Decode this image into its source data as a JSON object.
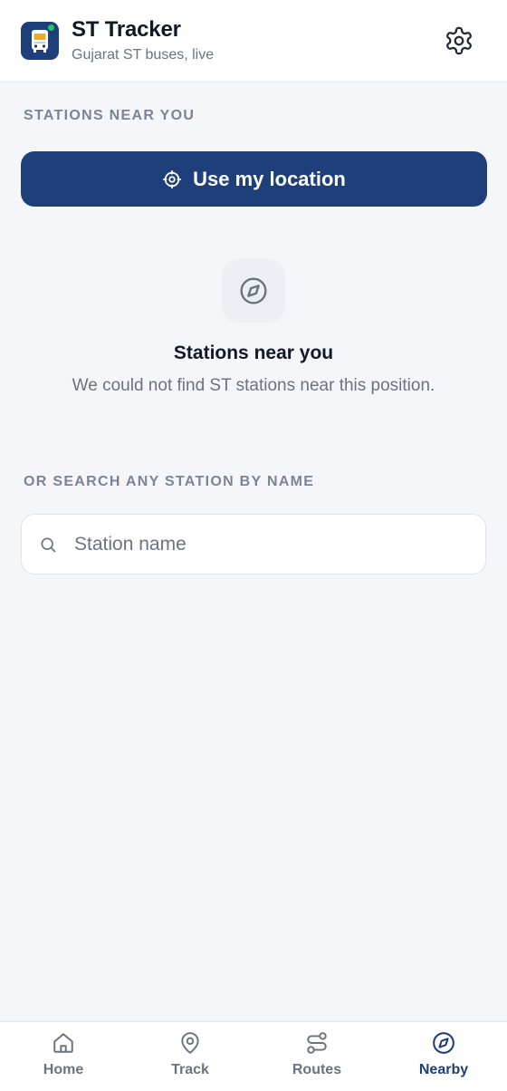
{
  "app": {
    "title": "ST Tracker",
    "subtitle": "Gujarat ST buses, live",
    "logo_icon": "bus-icon",
    "settings_icon": "gear-icon"
  },
  "nearby": {
    "section_label": "STATIONS NEAR YOU",
    "locate_button": {
      "label": "Use my location",
      "icon": "crosshair-icon"
    },
    "empty_state": {
      "icon": "compass-icon",
      "title": "Stations near you",
      "message": "We could not find ST stations near this position."
    }
  },
  "search": {
    "section_label": "OR SEARCH ANY STATION BY NAME",
    "placeholder": "Station name",
    "value": "",
    "icon": "search-icon"
  },
  "tabs": [
    {
      "label": "Home",
      "icon": "home-icon",
      "active": false
    },
    {
      "label": "Track",
      "icon": "map-pin-icon",
      "active": false
    },
    {
      "label": "Routes",
      "icon": "route-icon",
      "active": false
    },
    {
      "label": "Nearby",
      "icon": "compass-icon",
      "active": true
    }
  ],
  "colors": {
    "primary": "#1e3f7a",
    "live_dot": "#22c55e",
    "background": "#f4f6fa",
    "muted_text": "#6b7280",
    "section_label": "#7b8496"
  }
}
